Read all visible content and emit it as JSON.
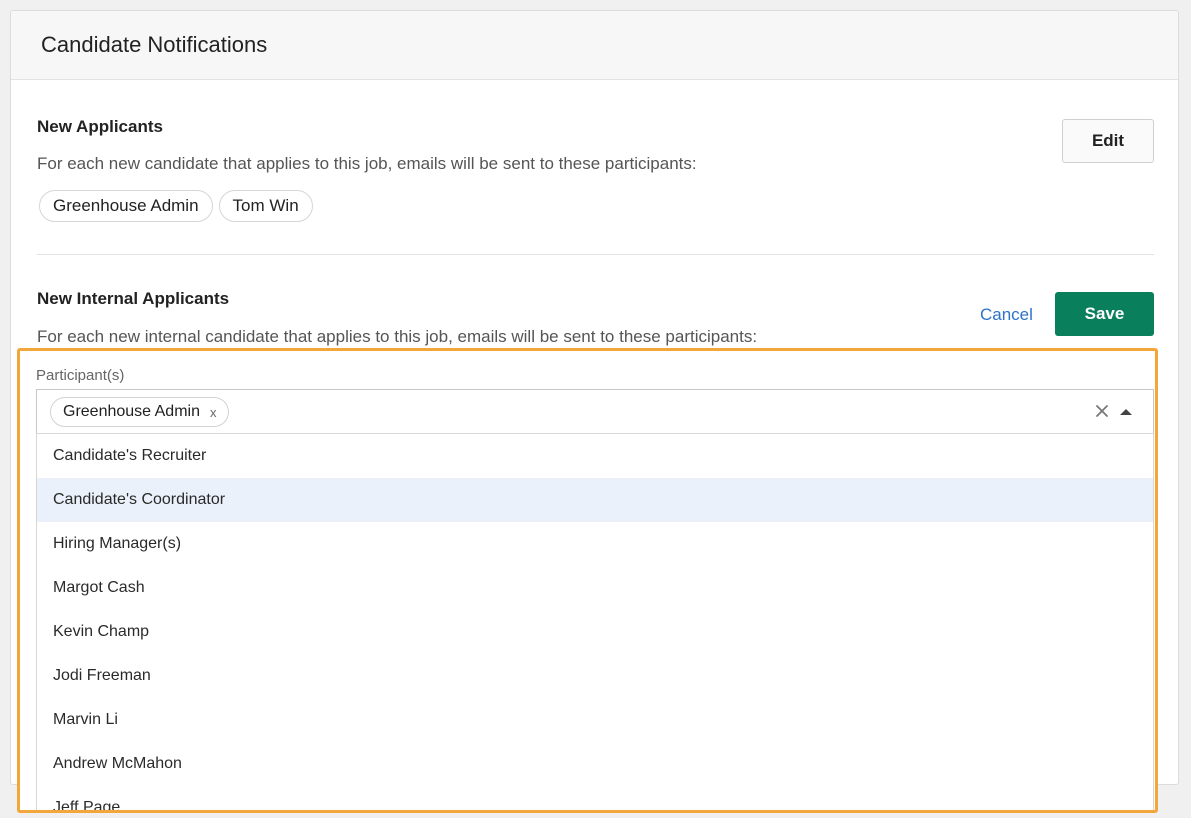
{
  "panel": {
    "title": "Candidate Notifications"
  },
  "new_applicants": {
    "title": "New Applicants",
    "description": "For each new candidate that applies to this job, emails will be sent to these participants:",
    "edit_label": "Edit",
    "participants": [
      "Greenhouse Admin",
      "Tom Win"
    ]
  },
  "new_internal_applicants": {
    "title": "New Internal Applicants",
    "description": "For each new internal candidate that applies to this job, emails will be sent to these participants:",
    "cancel_label": "Cancel",
    "save_label": "Save",
    "field_label": "Participant(s)",
    "selected": [
      "Greenhouse Admin"
    ],
    "chip_remove_glyph": "x",
    "options": [
      "Candidate's Recruiter",
      "Candidate's Coordinator",
      "Hiring Manager(s)",
      "Margot Cash",
      "Kevin Champ",
      "Jodi Freeman",
      "Marvin Li",
      "Andrew McMahon",
      "Jeff Page"
    ],
    "highlighted_option": "Candidate's Coordinator"
  },
  "colors": {
    "accent_green": "#0a7f5b",
    "link_blue": "#2d73c9",
    "highlight_orange": "#f3a639",
    "option_hover": "#eaf1fa"
  }
}
